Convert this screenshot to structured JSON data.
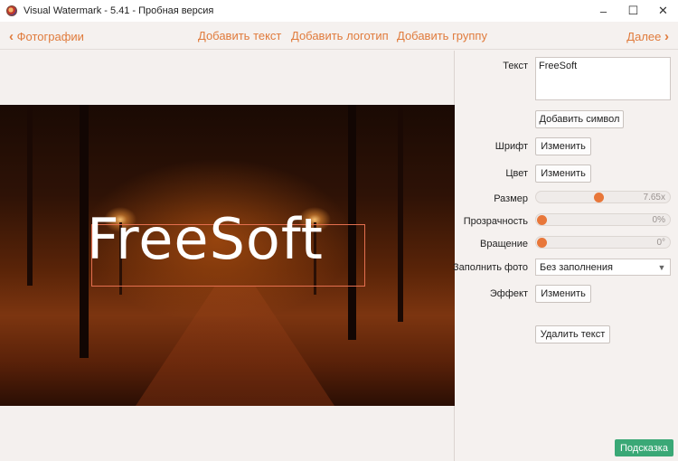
{
  "window": {
    "title": "Visual Watermark - 5.41 - Пробная версия",
    "minimize": "–",
    "maximize": "☐",
    "close": "✕"
  },
  "nav": {
    "back_chevron": "‹",
    "back_label": "Фотографии",
    "add_text": "Добавить текст",
    "add_logo": "Добавить логотип",
    "add_group": "Добавить группу",
    "next_label": "Далее",
    "next_chevron": "›"
  },
  "canvas": {
    "watermark_text": "FreeSoft"
  },
  "panel": {
    "text_label": "Текст",
    "text_value": "FreeSoft",
    "add_symbol_button": "Добавить символ",
    "font_label": "Шрифт",
    "font_button": "Изменить",
    "color_label": "Цвет",
    "color_button": "Изменить",
    "size_label": "Размер",
    "size_value_text": "7.65x",
    "size_fraction": 0.47,
    "opacity_label": "Прозрачность",
    "opacity_value_text": "0%",
    "opacity_fraction": 0.0,
    "rotation_label": "Вращение",
    "rotation_value_text": "0°",
    "rotation_fraction": 0.0,
    "fill_label": "Заполнить фото",
    "fill_value": "Без заполнения",
    "effect_label": "Эффект",
    "effect_button": "Изменить",
    "delete_button": "Удалить текст"
  },
  "footer": {
    "help_button": "Подсказка"
  },
  "colors": {
    "accent": "#e07b3c",
    "slider_thumb": "#e8773a",
    "help_button": "#3aa876",
    "watermark_border": "#e46f4f"
  }
}
